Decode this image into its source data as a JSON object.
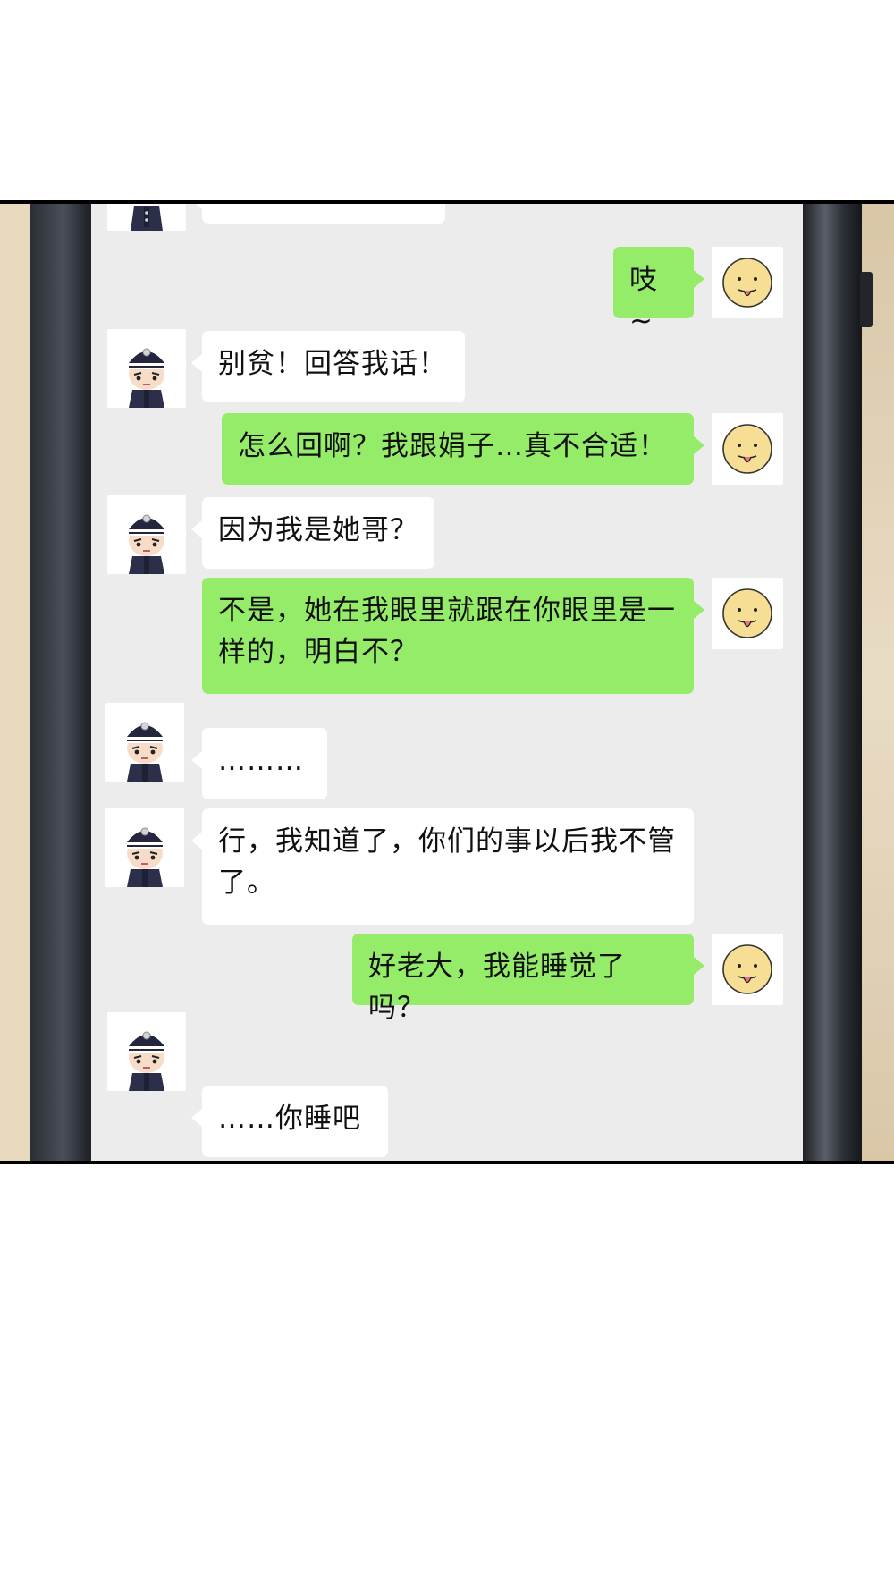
{
  "colors": {
    "sent_bubble": "#95ec69",
    "received_bubble": "#ffffff",
    "screen_bg": "#ececec"
  },
  "participants": {
    "contact": {
      "avatar_icon": "police-officer-avatar-icon"
    },
    "self": {
      "avatar_icon": "tongue-out-smiley-avatar-icon"
    }
  },
  "messages": [
    {
      "from": "contact",
      "text": ""
    },
    {
      "from": "self",
      "text": "吱~"
    },
    {
      "from": "contact",
      "text": "别贫！回答我话！"
    },
    {
      "from": "self",
      "text": "怎么回啊？我跟娟子…真不合适！"
    },
    {
      "from": "contact",
      "text": "因为我是她哥？"
    },
    {
      "from": "self",
      "text": "不是，她在我眼里就跟在你眼里是一样的，明白不？"
    },
    {
      "from": "contact",
      "text": "………"
    },
    {
      "from": "contact",
      "text": "行，我知道了，你们的事以后我不管了。"
    },
    {
      "from": "self",
      "text": "好老大，我能睡觉了吗？"
    },
    {
      "from": "contact",
      "text": "……你睡吧"
    }
  ]
}
